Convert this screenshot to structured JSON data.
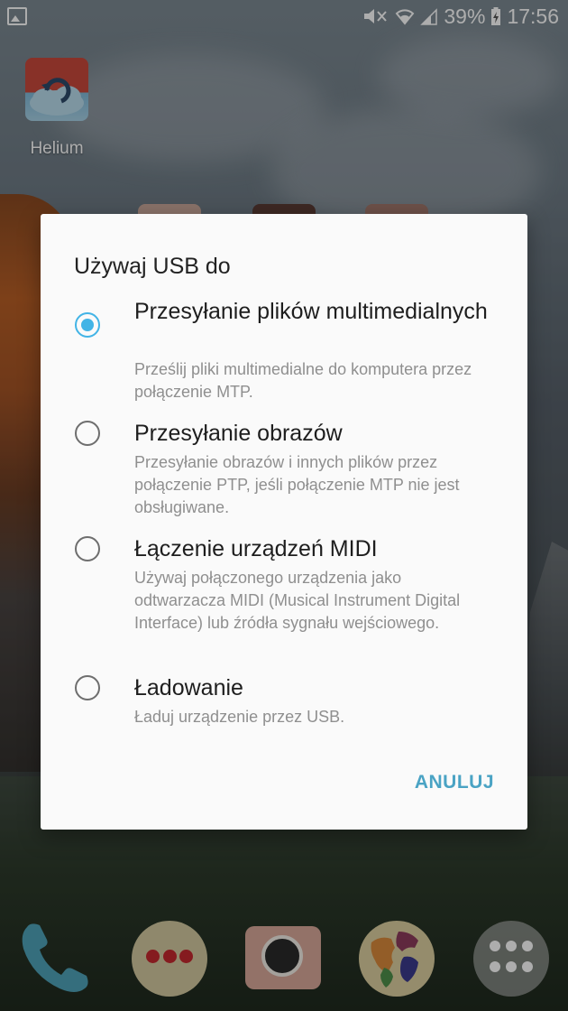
{
  "status_bar": {
    "battery_percent": "39%",
    "time": "17:56",
    "icons": [
      "gallery-notification-icon",
      "mute-icon",
      "wifi-icon",
      "signal-icon",
      "battery-charging-icon"
    ]
  },
  "home": {
    "apps": [
      {
        "label": "Helium",
        "icon": "helium-sync-icon"
      }
    ],
    "dock": [
      {
        "icon": "phone-icon"
      },
      {
        "icon": "messages-icon"
      },
      {
        "icon": "camera-icon"
      },
      {
        "icon": "globe-icon"
      },
      {
        "icon": "app-drawer-icon"
      }
    ]
  },
  "dialog": {
    "title": "Używaj USB do",
    "selected_index": 0,
    "options": [
      {
        "title": "Przesyłanie plików multimedialnych",
        "description": "Prześlij pliki multimedialne do komputera przez połączenie MTP."
      },
      {
        "title": "Przesyłanie obrazów",
        "description": "Przesyłanie obrazów i innych plików przez połączenie PTP, jeśli połączenie MTP nie jest obsługiwane."
      },
      {
        "title": "Łączenie urządzeń MIDI",
        "description": "Używaj połączonego urządzenia jako odtwarzacza MIDI (Musical Instrument Digital Interface) lub źródła sygnału wejściowego."
      },
      {
        "title": "Ładowanie",
        "description": "Ładuj urządzenie przez USB."
      }
    ],
    "cancel_label": "ANULUJ"
  },
  "colors": {
    "accent": "#42b4e6",
    "cancel_text": "#4aa3c4",
    "dialog_bg": "#fafafa"
  }
}
